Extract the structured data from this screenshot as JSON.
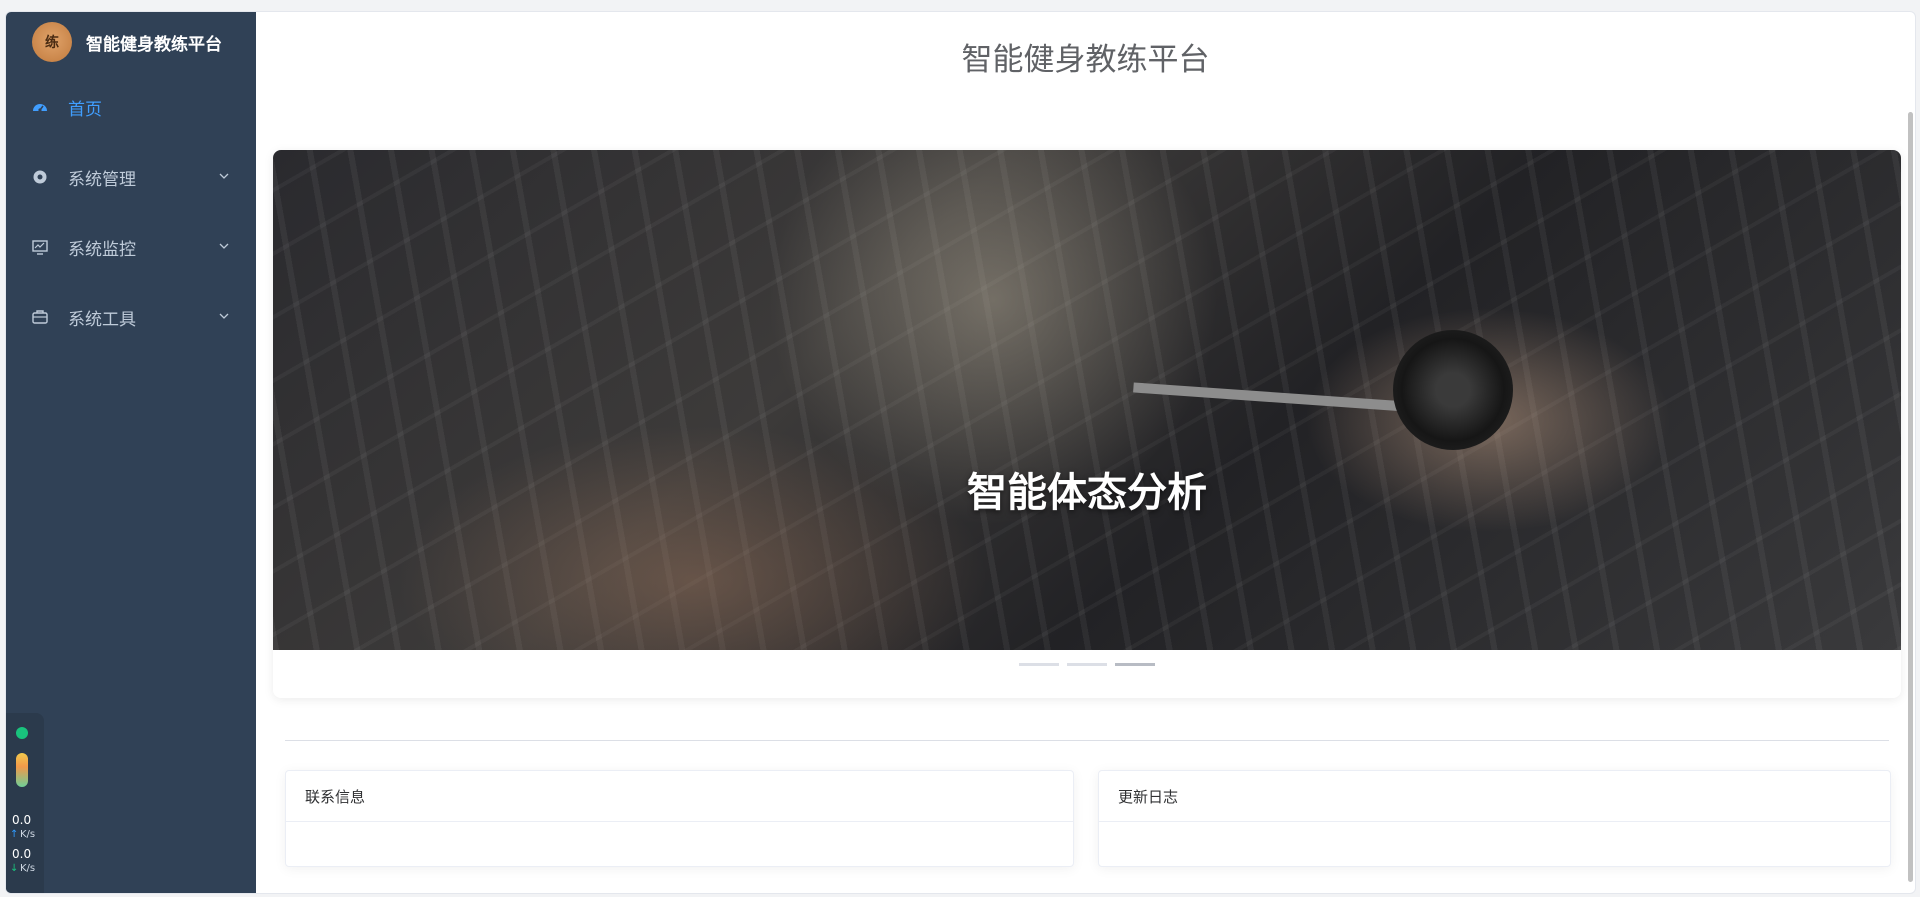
{
  "sidebar": {
    "brand_title": "智能健身教练平台",
    "logo_glyph": "练",
    "items": [
      {
        "label": "首页",
        "icon": "dashboard-icon",
        "active": true
      },
      {
        "label": "系统管理",
        "icon": "gear-icon"
      },
      {
        "label": "系统监控",
        "icon": "monitor-icon"
      },
      {
        "label": "系统工具",
        "icon": "toolbox-icon"
      }
    ]
  },
  "network": {
    "upload_value": "0.0",
    "upload_unit": "K/s",
    "download_value": "0.0",
    "download_unit": "K/s"
  },
  "main": {
    "title": "智能健身教练平台",
    "carousel": {
      "caption": "智能体态分析",
      "slide_count": 3,
      "active_index": 2
    },
    "cards": {
      "contact_title": "联系信息",
      "changelog_title": "更新日志"
    }
  },
  "colors": {
    "sidebar_bg": "#304156",
    "active": "#409eff",
    "menu_text": "#bfcbd9"
  }
}
